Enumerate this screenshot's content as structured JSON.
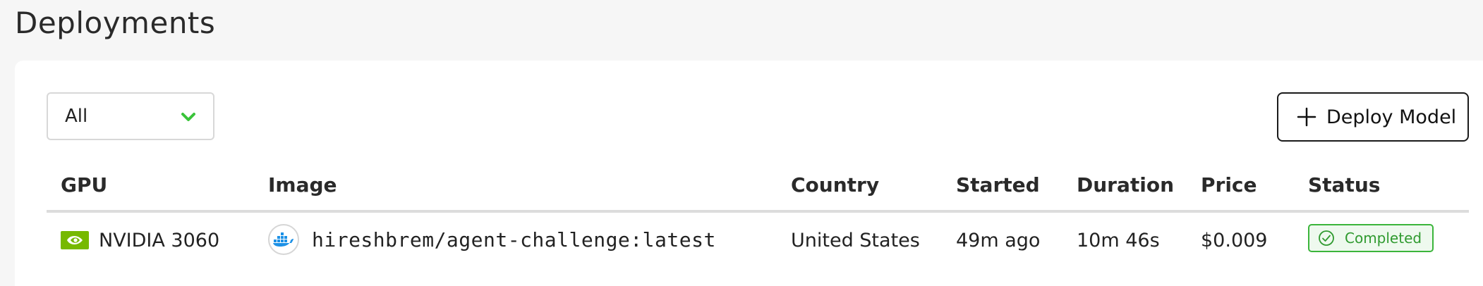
{
  "page": {
    "title": "Deployments"
  },
  "toolbar": {
    "filter": {
      "selected": "All"
    },
    "deploy_label": "Deploy Model"
  },
  "table": {
    "columns": {
      "gpu": "GPU",
      "image": "Image",
      "country": "Country",
      "started": "Started",
      "duration": "Duration",
      "price": "Price",
      "status": "Status"
    },
    "rows": [
      {
        "gpu": "NVIDIA 3060",
        "image": "hireshbrem/agent-challenge:latest",
        "country": "United States",
        "started": "49m ago",
        "duration": "10m 46s",
        "price": "$0.009",
        "status": "Completed"
      }
    ]
  },
  "colors": {
    "accent_green": "#3bb53b",
    "nvidia_green": "#76b900",
    "docker_blue": "#1d91e6"
  },
  "icons": {
    "filter_chevron": "chevron-down-icon",
    "deploy": "plus-icon",
    "gpu": "nvidia-logo-icon",
    "image": "docker-icon",
    "status": "check-circle-icon"
  }
}
